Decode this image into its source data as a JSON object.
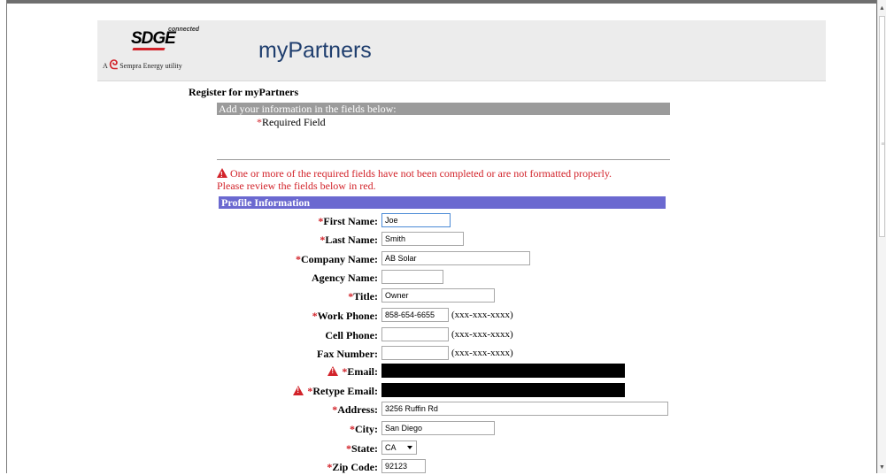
{
  "header": {
    "logo_brand": "SDGE",
    "logo_tag": "connected",
    "logo_parent": "Sempra Energy utility",
    "app_title": "myPartners"
  },
  "page": {
    "heading": "Register for myPartners",
    "instructions": "Add your information in the fields below:",
    "required_marker": "*",
    "required_note": "Required Field",
    "error_line1": "One or more of the required fields have not been completed or are not formatted properly.",
    "error_line2": "Please review the fields below in red."
  },
  "profile": {
    "section_title": "Profile Information",
    "fields": [
      {
        "key": "first_name",
        "label": "First Name:",
        "required": true,
        "value": "Joe"
      },
      {
        "key": "last_name",
        "label": "Last Name:",
        "required": true,
        "value": "Smith"
      },
      {
        "key": "company_name",
        "label": "Company Name:",
        "required": true,
        "value": "AB Solar"
      },
      {
        "key": "agency_name",
        "label": "Agency Name:",
        "required": false,
        "value": ""
      },
      {
        "key": "title",
        "label": "Title:",
        "required": true,
        "value": "Owner"
      },
      {
        "key": "work_phone",
        "label": "Work Phone:",
        "required": true,
        "value": "858-654-6655",
        "hint": "(xxx-xxx-xxxx)"
      },
      {
        "key": "cell_phone",
        "label": "Cell Phone:",
        "required": false,
        "value": "",
        "hint": "(xxx-xxx-xxxx)"
      },
      {
        "key": "fax_number",
        "label": "Fax Number:",
        "required": false,
        "value": "",
        "hint": "(xxx-xxx-xxxx)"
      },
      {
        "key": "email",
        "label": "Email:",
        "required": true,
        "value": "",
        "error": true,
        "redacted": true
      },
      {
        "key": "retype_email",
        "label": "Retype Email:",
        "required": true,
        "value": "",
        "error": true,
        "redacted": true
      },
      {
        "key": "address",
        "label": "Address:",
        "required": true,
        "value": "3256 Ruffin Rd"
      },
      {
        "key": "city",
        "label": "City:",
        "required": true,
        "value": "San Diego"
      },
      {
        "key": "state",
        "label": "State:",
        "required": true,
        "value": "CA"
      },
      {
        "key": "zip_code",
        "label": "Zip Code:",
        "required": true,
        "value": "92123"
      }
    ]
  },
  "colors": {
    "brand_red": "#d2232a",
    "title_blue": "#1f3e6e",
    "section_header": "#6b69d0",
    "instructions_bar": "#9b9b9b"
  }
}
